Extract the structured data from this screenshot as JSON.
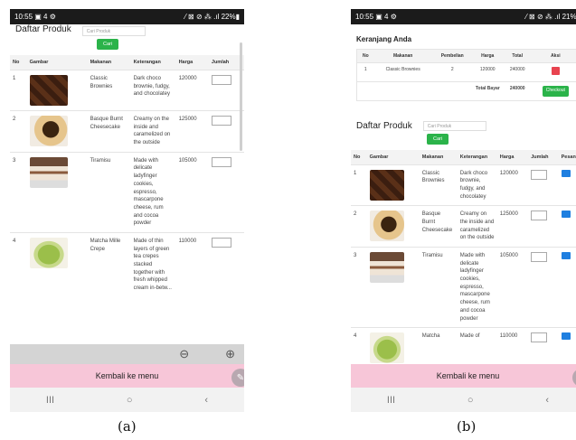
{
  "panel_a": {
    "status_time": "10:55",
    "status_icons": "▣ 4 ⚙",
    "status_right": "⁄ ⊠ ⊘ ⁂ .ıl 22%▮",
    "title": "Daftar Produk",
    "search_placeholder": "Cari Produk",
    "cari": "Cari",
    "headers": [
      "No",
      "Gambar",
      "Makanan",
      "Keterangan",
      "Harga",
      "Jumlah"
    ],
    "rows": [
      {
        "no": "1",
        "name": "Classic Brownies",
        "desc": "Dark choco brownie, fudgy, and chocolatey",
        "price": "120000"
      },
      {
        "no": "2",
        "name": "Basque Burnt Cheesecake",
        "desc": "Creamy on the inside and caramelized on the outside",
        "price": "125000"
      },
      {
        "no": "3",
        "name": "Tiramisu",
        "desc": "Made with delicate ladyfinger cookies, espresso, mascarpone cheese, rum and cocoa powder",
        "price": "105000"
      },
      {
        "no": "4",
        "name": "Matcha Mille Crepe",
        "desc": "Made of thin layers of green tea crepes stacked together with fresh whipped cream in-betw...",
        "price": "110000"
      }
    ],
    "back": "Kembali ke menu",
    "nav": [
      "III",
      "○",
      "‹"
    ],
    "label": "(a)"
  },
  "panel_b": {
    "status_time": "10:55",
    "status_icons": "▣ 4 ⚙",
    "status_right": "⁄ ⊠ ⊘ ⁂ .ıl 21%▮",
    "cart_title": "Keranjang Anda",
    "cart_headers": [
      "No",
      "Makanan",
      "Pembelian",
      "Harga",
      "Total",
      "Aksi"
    ],
    "cart_row": {
      "no": "1",
      "name": "Classic Brownies",
      "qty": "2",
      "price": "120000",
      "total": "240000"
    },
    "total_label": "Total Bayar",
    "total_value": "240000",
    "checkout": "Checkout",
    "title": "Daftar Produk",
    "search_placeholder": "Cari Produk",
    "cari": "Cari",
    "headers": [
      "No",
      "Gambar",
      "Makanan",
      "Keterangan",
      "Harga",
      "Jumlah",
      "Pesan"
    ],
    "rows": [
      {
        "no": "1",
        "name": "Classic Brownies",
        "desc": "Dark choco brownie, fudgy, and chocolatey",
        "price": "120000"
      },
      {
        "no": "2",
        "name": "Basque Burnt Cheesecake",
        "desc": "Creamy on the inside and caramelized on the outside",
        "price": "125000"
      },
      {
        "no": "3",
        "name": "Tiramisu",
        "desc": "Made with delicate ladyfinger cookies, espresso, mascarpone cheese, rum and cocoa powder",
        "price": "105000"
      },
      {
        "no": "4",
        "name": "Matcha",
        "desc": "Made of",
        "price": "110000"
      }
    ],
    "back": "Kembali ke menu",
    "nav": [
      "III",
      "○",
      "‹"
    ],
    "label": "(b)"
  }
}
